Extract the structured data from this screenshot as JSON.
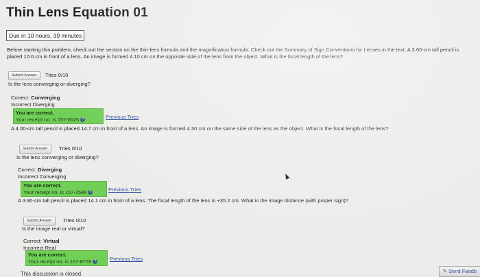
{
  "title": "Thin Lens Equation 01",
  "due": "Due in 10 hours, 39 minutes",
  "intro": "Before starting this problem, check out the section on the thin-lens formula and the magnification formula. Check out the Summary of Sign Conventions for Lenses in the text. A 3.60-cm tall pencil is placed 10.0 cm in front of a lens. An image is formed 4.10 cm on the opposite side of the lens from the object. What is the focal length of the lens?",
  "parts": [
    {
      "submit_label": "Submit Answer",
      "tries": "Tries 0/10",
      "question": "Is the lens converging or diverging?",
      "correct_label": "Correct:",
      "correct_value": "Converging",
      "incorrect": "Incorrect Diverging",
      "correct_head": "You are correct.",
      "receipt": "Your receipt no. is 157-6526",
      "previous_tries": "Previous Tries",
      "next_problem": "A 4.00-cm tall pencil is placed 14.7 cm in front of a lens. An image is formed 4.30 cm on the same side of the lens as the object. What is the focal length of the lens?"
    },
    {
      "submit_label": "Submit Answer",
      "tries": "Tries 0/10",
      "question": "Is the lens converging or diverging?",
      "correct_label": "Correct:",
      "correct_value": "Diverging",
      "incorrect": "Incorrect Converging",
      "correct_head": "You are correct.",
      "receipt": "Your receipt no. is 157-2588",
      "previous_tries": "Previous Tries",
      "next_problem": "A 3.90-cm tall pencil is placed 14.1 cm in front of a lens. The focal length of the lens is +35.2 cm. What is the image distance (with proper sign)?"
    },
    {
      "submit_label": "Submit Answer",
      "tries": "Tries 0/10",
      "question": "Is the image real or virtual?",
      "correct_label": "Correct:",
      "correct_value": "Virtual",
      "incorrect": "Incorrect Real",
      "correct_head": "You are correct.",
      "receipt": "Your receipt no. is 157-8776",
      "previous_tries": "Previous Tries"
    }
  ],
  "info_glyph": "?",
  "send_feedback": "Send Feedb",
  "footer_cut": "This discussion is closed.",
  "colors": {
    "correct_box": "#6fcf57",
    "link": "#2a4f9e"
  }
}
